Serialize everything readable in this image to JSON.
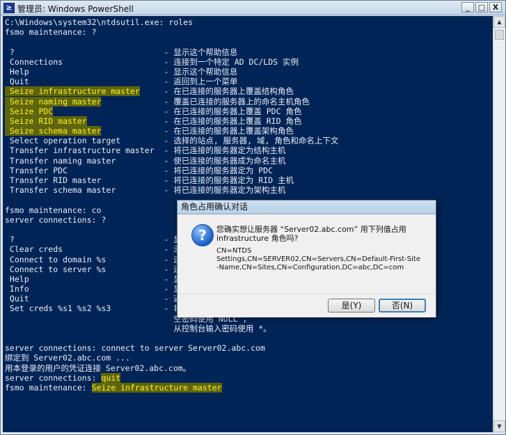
{
  "window": {
    "title": "管理员: Windows PowerShell",
    "icon": "powershell-icon",
    "buttons": {
      "minimize": "_",
      "maximize": "□",
      "close": "X"
    }
  },
  "console": {
    "lines": [
      {
        "text": "C:\\Windows\\system32\\ntdsutil.exe: roles"
      },
      {
        "text": "fsmo maintenance: ?"
      },
      {
        "text": ""
      },
      {
        "text": " ?                               - 显示这个帮助信息"
      },
      {
        "text": " Connections                     - 连接到一个特定 AD DC/LDS 实例"
      },
      {
        "text": " Help                            - 显示这个帮助信息"
      },
      {
        "text": " Quit                            - 返回到上一个菜单"
      },
      {
        "hl": " Seize infrastructure master",
        "text": "     - 在已连接的服务器上覆盖结构角色"
      },
      {
        "hl": " Seize naming master",
        "text": "             - 覆盖已连接的服务器上的命名主机角色"
      },
      {
        "hl": " Seize PDC",
        "text": "                       - 在已连接的服务器上覆盖 PDC 角色"
      },
      {
        "hl": " Seize RID master",
        "text": "                - 在已连接的服务器上覆盖 RID 角色"
      },
      {
        "hl": " Seize schema master",
        "text": "             - 在已连接的服务器上覆盖架构角色"
      },
      {
        "text": " Select operation target         - 选择的站点, 服务器, 域, 角色和命名上下文"
      },
      {
        "text": " Transfer infrastructure master  - 将已连接的服务器定为结构主机"
      },
      {
        "text": " Transfer naming master          - 使已连接的服务器成为命名主机"
      },
      {
        "text": " Transfer PDC                    - 将已连接的服务器定为 PDC"
      },
      {
        "text": " Transfer RID master             - 将已连接的服务器定为 RID 主机"
      },
      {
        "text": " Transfer schema master          - 将已连接的服务器定为架构主机"
      },
      {
        "text": ""
      },
      {
        "text": "fsmo maintenance: co"
      },
      {
        "text": "server connections: ?"
      },
      {
        "text": ""
      },
      {
        "text": " ?                               - 显"
      },
      {
        "text": " Clear creds                     - 清"
      },
      {
        "text": " Connect to domain %s            - 连"
      },
      {
        "text": " Connect to server %s            - 连"
      },
      {
        "text": " Help                            - 显"
      },
      {
        "text": " Info                            - 显"
      },
      {
        "text": " Quit                            - 返"
      },
      {
        "text": " Set creds %s1 %s2 %s3           - 将"
      },
      {
        "text": "                                   空密码使用\"NULL\","
      },
      {
        "text": "                                   从控制台输入密码使用 *。"
      },
      {
        "text": ""
      },
      {
        "text": "server connections: connect to server Server02.abc.com"
      },
      {
        "text": "绑定到 Server02.abc.com ..."
      },
      {
        "text": "用本登录的用户的凭证连接 Server02.abc.com。"
      },
      {
        "text": "server connections: ",
        "hl_after": "quit"
      },
      {
        "text": "fsmo maintenance: ",
        "hl_after": "Seize infrastructure master"
      }
    ]
  },
  "dialog": {
    "title": "角色占用确认对话",
    "icon": "question-icon",
    "message_line1": "您确实想让服务器 “Server02.abc.com” 用下列值占用",
    "message_line2": "infrastructure 角色吗?",
    "detail_line1": "CN=NTDS",
    "detail_line2": "Settings,CN=SERVER02,CN=Servers,CN=Default-First-Site",
    "detail_line3": "-Name,CN=Sites,CN=Configuration,DC=abc,DC=com",
    "yes_label": "是(Y)",
    "no_label": "否(N)"
  },
  "colors": {
    "console_bg": "#012456",
    "console_text": "#e9eef6",
    "highlight_bg": "#5e650a",
    "highlight_text": "#fff22a"
  }
}
